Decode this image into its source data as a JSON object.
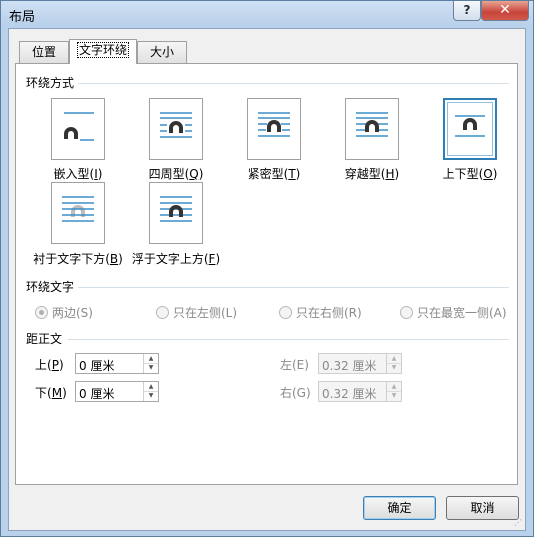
{
  "window": {
    "title": "布局",
    "help": "?",
    "close": "✕"
  },
  "tabs": [
    {
      "label": "位置"
    },
    {
      "label": "文字环绕"
    },
    {
      "label": "大小"
    }
  ],
  "wrap_style": {
    "title": "环绕方式",
    "options": [
      {
        "label": "嵌入型",
        "key": "I"
      },
      {
        "label": "四周型",
        "key": "Q"
      },
      {
        "label": "紧密型",
        "key": "T"
      },
      {
        "label": "穿越型",
        "key": "H"
      },
      {
        "label": "上下型",
        "key": "O"
      },
      {
        "label": "衬于文字下方",
        "key": "B"
      },
      {
        "label": "浮于文字上方",
        "key": "F"
      }
    ],
    "selected": "上下型"
  },
  "wrap_text": {
    "title": "环绕文字",
    "options": [
      {
        "label": "两边(S)",
        "checked": true
      },
      {
        "label": "只在左侧(L)",
        "checked": false
      },
      {
        "label": "只在右侧(R)",
        "checked": false
      },
      {
        "label": "只在最宽一侧(A)",
        "checked": false
      }
    ]
  },
  "distance": {
    "title": "距正文",
    "top": {
      "label": "上",
      "key": "P",
      "value": "0 厘米"
    },
    "bottom": {
      "label": "下",
      "key": "M",
      "value": "0 厘米"
    },
    "left": {
      "label": "左(E)",
      "value": "0.32 厘米"
    },
    "right": {
      "label": "右(G)",
      "value": "0.32 厘米"
    }
  },
  "buttons": {
    "ok": "确定",
    "cancel": "取消"
  },
  "colors": {
    "accent": "#2f7fb4",
    "line_blue": "#3a8fc8",
    "arch": "#333333"
  }
}
